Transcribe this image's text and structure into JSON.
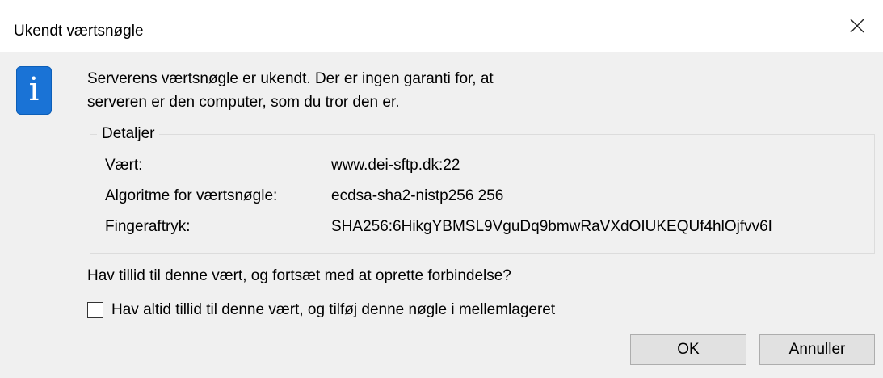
{
  "dialog": {
    "title": "Ukendt værtsnøgle",
    "message_line1": "Serverens værtsnøgle er ukendt. Der er ingen garanti for, at",
    "message_line2": "serveren er den computer, som du tror den er.",
    "details": {
      "legend": "Detaljer",
      "rows": [
        {
          "label": "Vært:",
          "value": "www.dei-sftp.dk:22"
        },
        {
          "label": "Algoritme for værtsnøgle:",
          "value": "ecdsa-sha2-nistp256 256"
        },
        {
          "label": "Fingeraftryk:",
          "value": "SHA256:6HikgYBMSL9VguDq9bmwRaVXdOIUKEQUf4hlOjfvv6I"
        }
      ]
    },
    "question": "Hav tillid til denne vært, og fortsæt med at oprette forbindelse?",
    "checkbox_label": "Hav altid tillid til denne vært, og tilføj denne nøgle i mellemlageret",
    "checkbox_checked": false,
    "ok_label": "OK",
    "cancel_label": "Annuller",
    "icons": {
      "close": "close-icon",
      "info": "info-icon"
    },
    "colors": {
      "info_icon": "#1a73d6",
      "dialog_bg": "#f0f0f0"
    }
  }
}
